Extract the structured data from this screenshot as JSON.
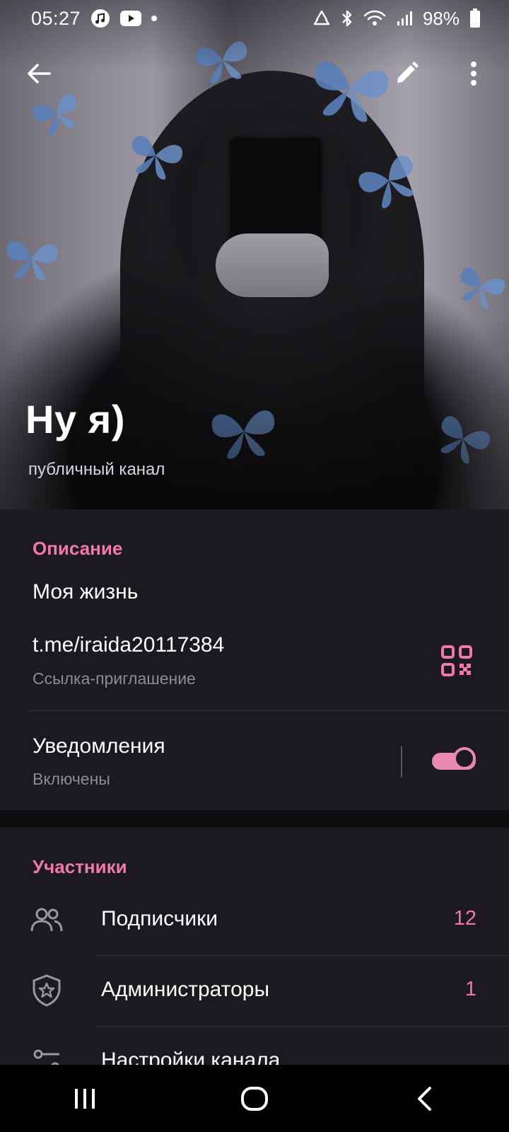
{
  "status_bar": {
    "time": "05:27",
    "battery": "98%",
    "icons": [
      "music-app-icon",
      "youtube-icon",
      "notification-dot",
      "recycle-icon",
      "bluetooth-icon",
      "wifi-icon",
      "signal-icon",
      "battery-icon"
    ]
  },
  "header": {
    "title": "Ну я)",
    "subtitle": "публичный канал",
    "icons": [
      "back-arrow-icon",
      "pencil-icon",
      "more-vert-icon"
    ]
  },
  "info": {
    "section_label": "Описание",
    "description": "Моя жизнь",
    "link": "t.me/iraida20117384",
    "link_caption": "Ссылка-приглашение",
    "notifications_label": "Уведомления",
    "notifications_state": "Включены",
    "notifications_enabled": true
  },
  "members": {
    "section_label": "Участники",
    "rows": [
      {
        "label": "Подписчики",
        "count": "12",
        "icon": "people-icon"
      },
      {
        "label": "Администраторы",
        "count": "1",
        "icon": "shield-star-icon"
      },
      {
        "label": "Настройки канала",
        "count": "",
        "icon": "settings-sliders-icon"
      }
    ]
  },
  "nav_bar": {
    "buttons": [
      "recent-apps-icon",
      "home-icon",
      "back-icon"
    ]
  },
  "colors": {
    "accent": "#f07aa5",
    "background": "#1c1a1e",
    "caption": "#8e8b92"
  }
}
